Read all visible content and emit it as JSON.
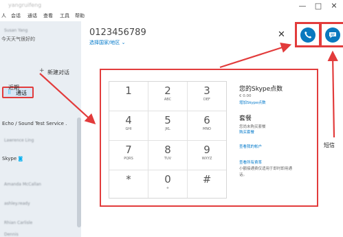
{
  "window": {
    "title": "yangruifeng",
    "controls": {
      "minimize": "—",
      "maximize": "□",
      "close": "✕"
    }
  },
  "menu": [
    "人",
    "会话",
    "通话",
    "查看",
    "工具",
    "帮助"
  ],
  "sidebar": {
    "profile_name": "Susan Yang",
    "status_message": "今天天气很好的",
    "tab_calls": "通话",
    "new_conversation": "新建对话",
    "recent": "近期",
    "contacts": [
      "Echo / Sound Test Service .",
      "Lawrence Ling",
      "Skype",
      "Amanda McCallan",
      "ashley.ready",
      "Rhian Carlisle",
      "Dennis"
    ],
    "new_conversation_icon": "plus-icon",
    "calls_icon": "dialpad-icon",
    "skype_badge": "verified-icon"
  },
  "dialer": {
    "phone_number": "0123456789",
    "country_link": "选择国家/地区",
    "keys": [
      {
        "digit": "1",
        "letters": ""
      },
      {
        "digit": "2",
        "letters": "ABC"
      },
      {
        "digit": "3",
        "letters": "DEF"
      },
      {
        "digit": "4",
        "letters": "GHI"
      },
      {
        "digit": "5",
        "letters": "JKL"
      },
      {
        "digit": "6",
        "letters": "MNO"
      },
      {
        "digit": "7",
        "letters": "PQRS"
      },
      {
        "digit": "8",
        "letters": "TUV"
      },
      {
        "digit": "9",
        "letters": "WXYZ"
      },
      {
        "digit": "*",
        "letters": ""
      },
      {
        "digit": "0",
        "letters": "+"
      },
      {
        "digit": "#",
        "letters": ""
      }
    ]
  },
  "credit_panel": {
    "title": "您的Skype点数",
    "balance": "€ 0.00",
    "add_credit": "增加Skype点数",
    "plans_title": "套餐",
    "plans_status": "您尚未购买套餐",
    "buy_plan": "购买套餐",
    "view_account": "查看我的帐户",
    "view_rates": "查看所有费率",
    "note_line1": "小额接通费仅适用于即时即用通",
    "note_line2": "话。"
  },
  "annotation": {
    "sms_label": "短信",
    "arrow_color": "#e23b3b"
  },
  "colors": {
    "accent": "#0a78be",
    "link": "#0078ca",
    "highlight": "#e23b3b",
    "sidebar_bg": "#e9eef3"
  }
}
